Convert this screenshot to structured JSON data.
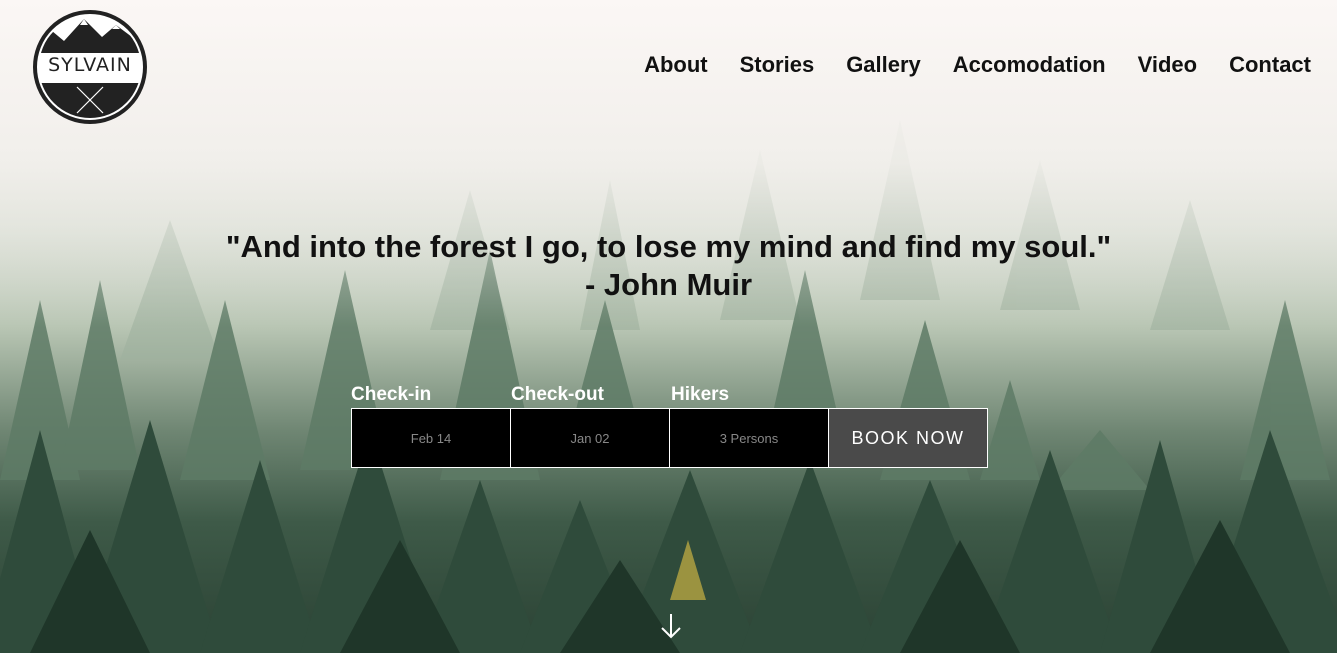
{
  "brand": {
    "name": "SYLVAIN"
  },
  "nav": {
    "items": [
      {
        "label": "About"
      },
      {
        "label": "Stories"
      },
      {
        "label": "Gallery"
      },
      {
        "label": "Accomodation"
      },
      {
        "label": "Video"
      },
      {
        "label": "Contact"
      }
    ]
  },
  "hero": {
    "quote_line1": "\"And into the forest I go, to lose my mind and find my soul.\"",
    "quote_line2": "- John Muir"
  },
  "booking": {
    "checkin_label": "Check-in",
    "checkout_label": "Check-out",
    "hikers_label": "Hikers",
    "checkin_value": "Feb 14",
    "checkout_value": "Jan 02",
    "hikers_value": "3 Persons",
    "book_label": "BOOK NOW"
  },
  "icons": {
    "scroll": "arrow-down-icon",
    "logo": "mountain-logo-icon"
  }
}
